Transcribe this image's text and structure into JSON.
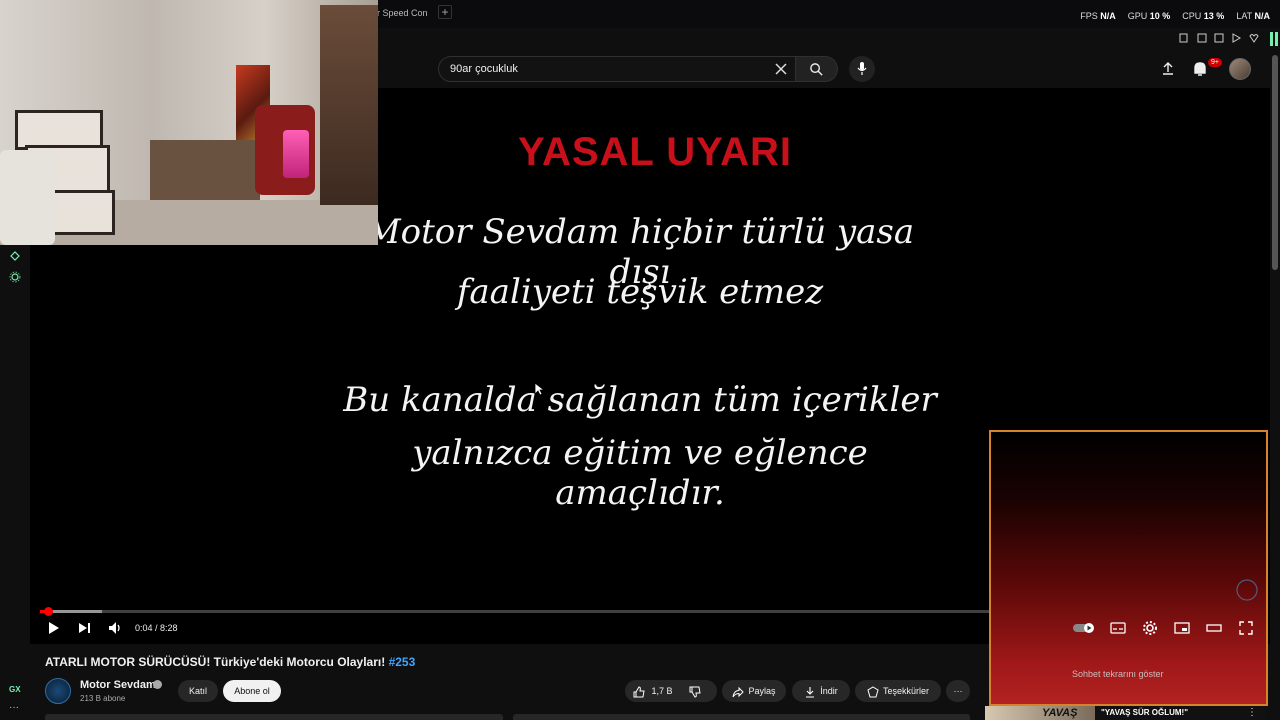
{
  "browser": {
    "tab_title": "er Speed Con",
    "new_tab": "+",
    "metrics": [
      {
        "label": "FPS",
        "value": "N/A"
      },
      {
        "label": "GPU",
        "value": "10 %"
      },
      {
        "label": "CPU",
        "value": "13 %"
      },
      {
        "label": "LAT",
        "value": "N/A"
      }
    ]
  },
  "header": {
    "search_value": "90ar çocukluk",
    "notification_badge": "9+"
  },
  "video": {
    "overlay_title": "YASAL UYARI",
    "overlay_lines": [
      "Motor Sevdam hiçbir türlü yasa dışı",
      "faaliyeti teşvik etmez",
      "Bu kanalda sağlanan tüm içerikler",
      "yalnızca eğitim ve eğlence amaçlıdır."
    ],
    "time": "0:04 / 8:28",
    "progress_fraction": 0.008
  },
  "chat_overlay": {
    "show_chat": "Sohbet tekrarını göster"
  },
  "details": {
    "title": "ATARLI MOTOR SÜRÜCÜSÜ! Türkiye'deki Motorcu Olayları!",
    "hashtag": "#253",
    "channel_name": "Motor Sevdam",
    "subscribers": "213 B abone",
    "join_label": "Katıl",
    "subscribe_label": "Abone ol",
    "likes": "1,7 B",
    "share_label": "Paylaş",
    "download_label": "İndir",
    "thanks_label": "Teşekkürler",
    "more_label": "···"
  },
  "banner": {
    "brand": "YAVAŞ",
    "text": "\"YAVAŞ SÜR OĞLUM!\"",
    "more": "⋮"
  },
  "sidebar": {
    "gx_label": "GX",
    "more": "···"
  },
  "colors": {
    "warning_red": "#c8101a",
    "progress_red": "#ff0000",
    "overlay_border": "#d9822b",
    "accent_green": "#76f0b0",
    "hashtag_blue": "#3ea6ff"
  }
}
